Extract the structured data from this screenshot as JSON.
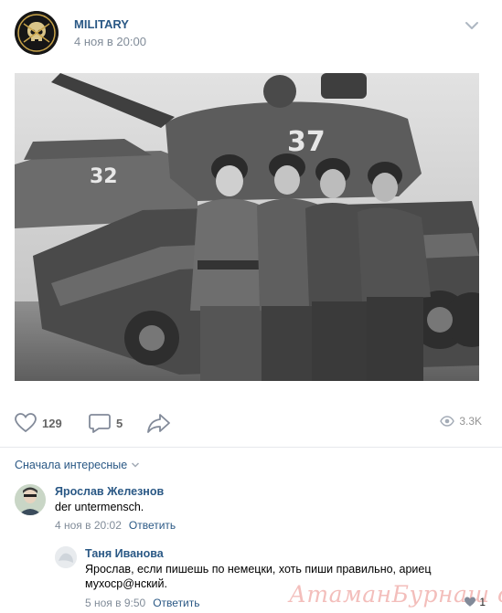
{
  "post": {
    "author": "MILITARY",
    "date": "4 ноя в 20:00",
    "likes": "129",
    "comments": "5",
    "views": "3.3K",
    "photo": {
      "tank_number_front": "37",
      "tank_number_back": "32"
    }
  },
  "comments_section": {
    "sort_label": "Сначала интересные"
  },
  "comments": [
    {
      "author": "Ярослав Железнов",
      "text": "der untermensch.",
      "date": "4 ноя в 20:02",
      "reply_label": "Ответить"
    },
    {
      "author": "Таня Иванова",
      "text": "Ярослав, если пишешь по немецки, хоть пиши правильно, ариец мухоср@нский.",
      "date": "5 ноя в 9:50",
      "reply_label": "Ответить",
      "likes": "1"
    }
  ],
  "watermark": "АтаманБурнаш для ЯП",
  "colors": {
    "link": "#2a5885",
    "meta": "#818c99",
    "icon": "#828a99"
  }
}
